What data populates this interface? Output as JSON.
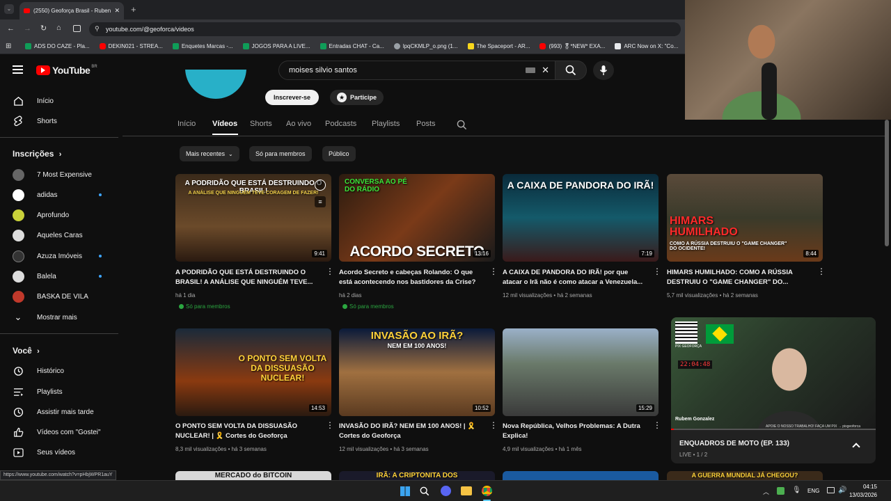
{
  "browser": {
    "tab_title": "(2550) Geoforça Brasil - Ruben",
    "url": "youtube.com/@geoforca/videos",
    "bookmarks": [
      {
        "label": "ADS DO CAZE - Pla...",
        "color": "#0f9d58"
      },
      {
        "label": "DEKIN021 - STREA...",
        "color": "#ff0000"
      },
      {
        "label": "Enquetes Marcas -...",
        "color": "#0f9d58"
      },
      {
        "label": "JOGOS PARA A LIVE...",
        "color": "#0f9d58"
      },
      {
        "label": "Entradas CHAT - Ca...",
        "color": "#0f9d58"
      },
      {
        "label": "lpqCKMLP_o.png (1...",
        "color": "#9aa0a6"
      },
      {
        "label": "The Spaceport - AR...",
        "color": "#f9d71c"
      },
      {
        "label": "(993) 🎖*NEW* EXA...",
        "color": "#ff0000"
      },
      {
        "label": "ARC Now on X: \"Co...",
        "color": "#e8eaed"
      }
    ],
    "status_url": "https://www.youtube.com/watch?v=pHbjWPR1auY"
  },
  "header": {
    "logo": "YouTube",
    "country": "BR",
    "search_value": "moises silvio santos"
  },
  "channel": {
    "subscribe": "Inscrever-se",
    "join": "Participe",
    "tabs": [
      "Início",
      "Vídeos",
      "Shorts",
      "Ao vivo",
      "Podcasts",
      "Playlists",
      "Posts"
    ],
    "active_tab": "Vídeos",
    "chips": [
      "Mais recentes",
      "Só para membros",
      "Público"
    ]
  },
  "sidebar": {
    "home": "Início",
    "shorts": "Shorts",
    "subs_heading": "Inscrições",
    "subs": [
      {
        "label": "7 Most Expensive",
        "color": "#666",
        "dot": false
      },
      {
        "label": "adidas",
        "color": "#fff",
        "dot": true
      },
      {
        "label": "Aprofundo",
        "color": "#c9d13a",
        "dot": false
      },
      {
        "label": "Aqueles Caras",
        "color": "#ddd",
        "dot": false
      },
      {
        "label": "Azuza Imóveis",
        "color": "#333",
        "dot": true
      },
      {
        "label": "Balela",
        "color": "#ddd",
        "dot": true
      },
      {
        "label": "BASKA DE VILA",
        "color": "#c0392b",
        "dot": false
      }
    ],
    "show_more": "Mostrar mais",
    "you_heading": "Você",
    "you_items": [
      "Histórico",
      "Playlists",
      "Assistir mais tarde",
      "Vídeos com \"Gostei\"",
      "Seus vídeos"
    ]
  },
  "videos": [
    {
      "thumb_text": "A PODRIDÃO QUE ESTÁ DESTRUINDO O BRASIL!",
      "thumb_sub": "A ANÁLISE QUE NINGUÉM TEVE CORAGEM DE FAZER!",
      "duration": "9:41",
      "title": "A PODRIDÃO QUE ESTÁ DESTRUINDO O BRASIL! A ANÁLISE QUE NINGUÉM TEVE...",
      "meta": "há 1 dia",
      "badge": "Só para membros",
      "bg": "linear-gradient(180deg,#3a2a1a,#6b4a2a 60%,#2a1a10)"
    },
    {
      "thumb_text": "ACORDO SECRETO",
      "thumb_sub": "CONVERSA AO PÉ DO RÁDIO",
      "duration": "13:16",
      "title": "Acordo Secreto e cabeças Rolando: O que está acontecendo nos bastidores da Crise?",
      "meta": "há 2 dias",
      "badge": "Só para membros",
      "bg": "linear-gradient(135deg,#2b1b10,#7a3a18 50%,#1a1a1a)"
    },
    {
      "thumb_text": "A CAIXA DE PANDORA DO IRÃ!",
      "thumb_sub": "",
      "duration": "7:19",
      "title": "A CAIXA DE PANDORA DO IRÃ! por que atacar o Irã não é como atacar a Venezuela...",
      "meta": "12 mil visualizações • há 2 semanas",
      "badge": "",
      "bg": "linear-gradient(180deg,#0a2a3a,#145a6a 50%,#3a1a1a)"
    },
    {
      "thumb_text": "HIMARS HUMILHADO",
      "thumb_sub": "COMO A RÚSSIA DESTRUIU O \"GAME CHANGER\" DO OCIDENTE!",
      "duration": "8:44",
      "title": "HIMARS HUMILHADO: COMO A RÚSSIA DESTRUIU O \"GAME CHANGER\" DO...",
      "meta": "5,7 mil visualizações • há 2 semanas",
      "badge": "",
      "bg": "linear-gradient(180deg,#5a4a3a,#3a3a2a 50%,#6a3a1a)"
    },
    {
      "thumb_text": "O PONTO SEM VOLTA DA DISSUASÃO NUCLEAR!",
      "thumb_sub": "",
      "duration": "14:53",
      "title": "O PONTO SEM VOLTA DA DISSUASÃO NUCLEAR! | 🎗️ Cortes do Geoforça",
      "meta": "8,3 mil visualizações • há 3 semanas",
      "badge": "",
      "bg": "linear-gradient(180deg,#1a2a3a,#8a3a10 60%,#2a1a10)"
    },
    {
      "thumb_text": "INVASÃO AO IRÃ?",
      "thumb_sub": "NEM EM 100 ANOS!",
      "duration": "10:52",
      "title": "INVASÃO DO IRÃ? NEM EM 100 ANOS! | 🎗️ Cortes do Geoforça",
      "meta": "12 mil visualizações • há 3 semanas",
      "badge": "",
      "bg": "linear-gradient(180deg,#0a1a3a,#a07040 50%,#5a3a20)"
    },
    {
      "thumb_text": "",
      "thumb_sub": "",
      "duration": "15:29",
      "title": "Nova República, Velhos Problemas: A Dutra Explica!",
      "meta": "4,9 mil visualizações • há 1 mês",
      "badge": "",
      "bg": "linear-gradient(180deg,#9ab0c8,#6a7a6a 40%,#3a3a3a)"
    }
  ],
  "next_row_hints": [
    "MERCADO do BITCOIN",
    "IRÃ: A CRIPTONITA DOS",
    "",
    "A GUERRA MUNDIAL JÁ CHEGOU?"
  ],
  "pip": {
    "presenter": "Rubem Gonzalez",
    "support_text": "APOIE O NOSSO TRABALHO! FAÇA UM PIX → pixgeoforca",
    "clock": "22:04:48",
    "title": "ENQUADROS DE MOTO (EP. 133)",
    "sub": "LIVE • 1 / 2",
    "qr_label": "PIX GEOFORÇA"
  },
  "taskbar": {
    "lang": "ENG",
    "time": "04:15",
    "date": "13/03/2026"
  }
}
